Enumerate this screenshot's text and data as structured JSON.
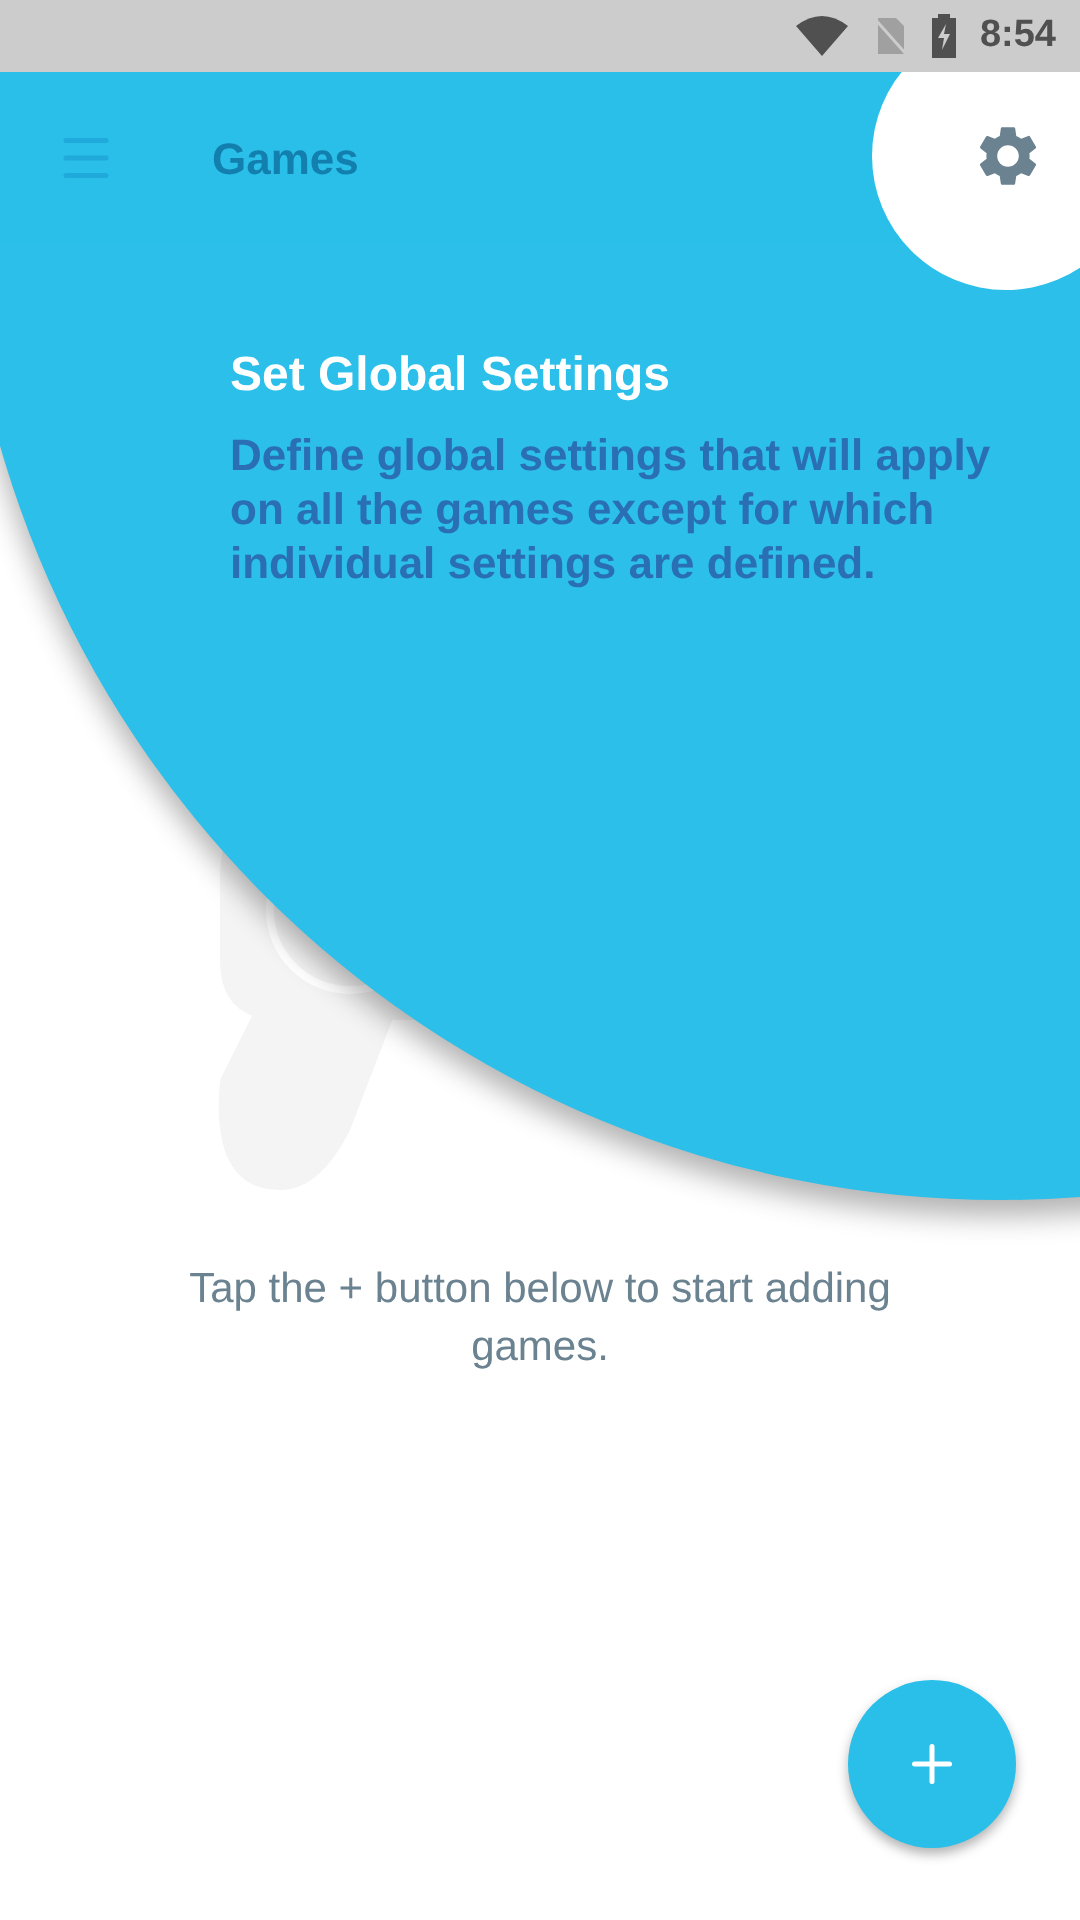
{
  "status_bar": {
    "time": "8:54"
  },
  "app_bar": {
    "title": "Games"
  },
  "tap_target": {
    "title": "Set Global Settings",
    "description": "Define global settings that will apply on all the games except for which individual settings are defined."
  },
  "empty_state": {
    "message": "Tap the + button below to start adding games."
  }
}
